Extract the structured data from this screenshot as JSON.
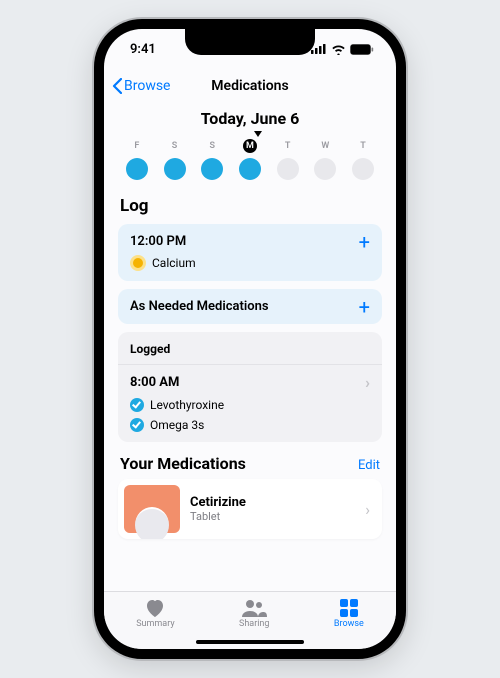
{
  "statusbar": {
    "time": "9:41"
  },
  "nav": {
    "back_label": "Browse",
    "title": "Medications"
  },
  "today": {
    "title": "Today, June 6",
    "days": [
      {
        "letter": "F",
        "filled": true,
        "active": false
      },
      {
        "letter": "S",
        "filled": true,
        "active": false
      },
      {
        "letter": "S",
        "filled": true,
        "active": false
      },
      {
        "letter": "M",
        "filled": true,
        "active": true
      },
      {
        "letter": "T",
        "filled": false,
        "active": false
      },
      {
        "letter": "W",
        "filled": false,
        "active": false
      },
      {
        "letter": "T",
        "filled": false,
        "active": false
      }
    ]
  },
  "log": {
    "title": "Log",
    "scheduled": {
      "time": "12:00 PM",
      "meds": [
        {
          "name": "Calcium",
          "icon": "pill"
        }
      ]
    },
    "as_needed": {
      "label": "As Needed Medications"
    },
    "logged": {
      "label": "Logged",
      "time": "8:00 AM",
      "meds": [
        {
          "name": "Levothyroxine"
        },
        {
          "name": "Omega 3s"
        }
      ]
    }
  },
  "your_meds": {
    "title": "Your Medications",
    "edit_label": "Edit",
    "items": [
      {
        "name": "Cetirizine",
        "form": "Tablet"
      }
    ]
  },
  "tabs": {
    "summary": "Summary",
    "sharing": "Sharing",
    "browse": "Browse"
  }
}
